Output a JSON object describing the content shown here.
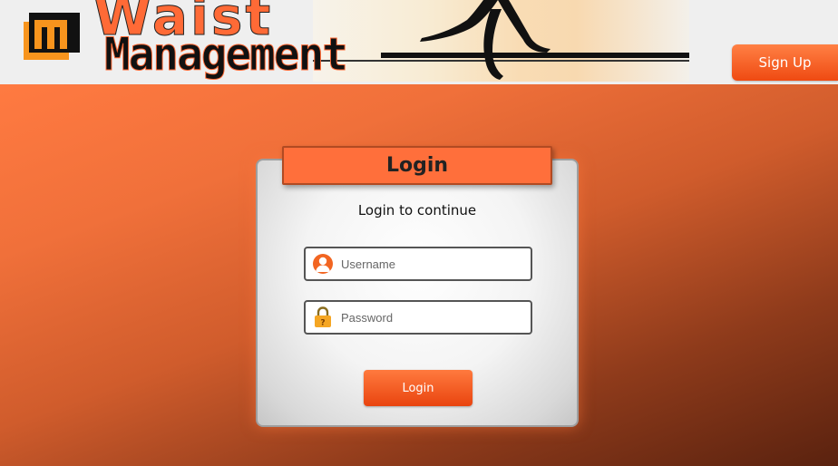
{
  "header": {
    "logo_word_top": "Waist",
    "logo_word_bottom": "Management",
    "signup_label": "Sign Up"
  },
  "login": {
    "title": "Login",
    "subtitle": "Login to continue",
    "username_placeholder": "Username",
    "username_value": "",
    "password_placeholder": "Password",
    "password_value": "",
    "submit_label": "Login"
  },
  "icons": {
    "logo": "waist-management-logo-icon",
    "banner": "runner-silhouette-icon",
    "username": "user-icon",
    "password": "lock-icon"
  },
  "colors": {
    "accent": "#ff6f3b",
    "button": "#ef4a12",
    "header_bg": "#efefef",
    "background_dark": "#5a220f"
  }
}
